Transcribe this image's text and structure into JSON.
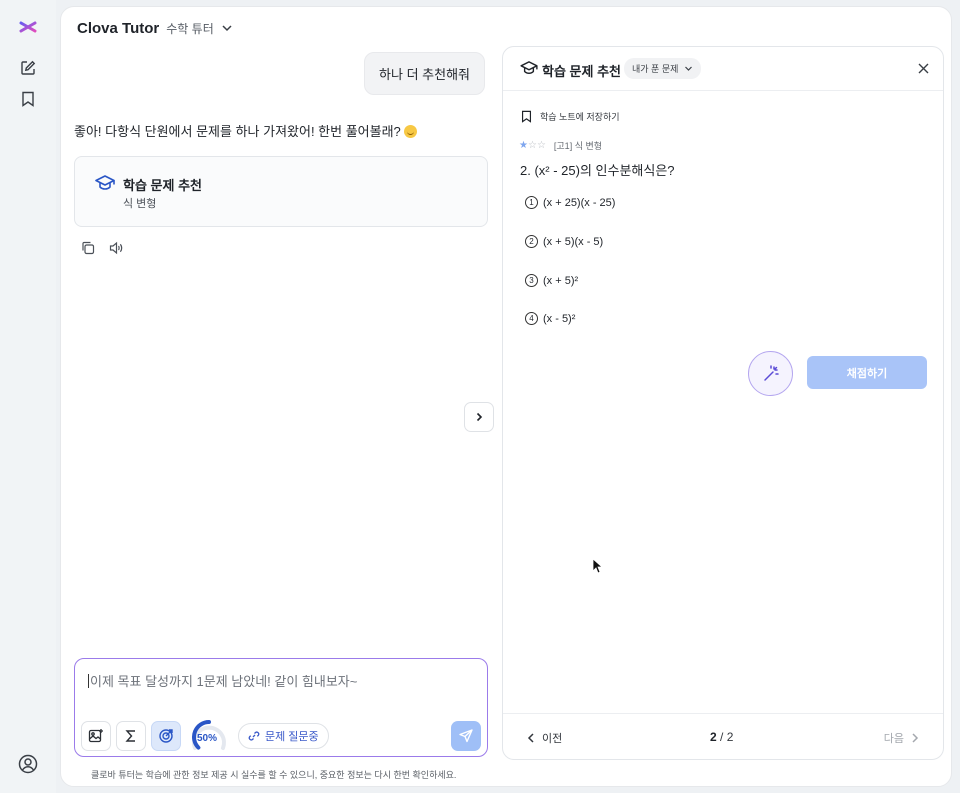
{
  "header": {
    "app_title": "Clova Tutor",
    "app_subtitle": "수학 튜터"
  },
  "chat": {
    "user_message": "하나 더 추천해줘",
    "bot_message": "좋아! 다항식 단원에서 문제를 하나 가져왔어! 한번 풀어볼래?",
    "recommend_card": {
      "title": "학습 문제 추천",
      "subtitle": "식 변형"
    }
  },
  "composer": {
    "placeholder": "이제 목표 달성까지 1문제 남았네! 같이 힘내보자~",
    "progress": {
      "percent": 50,
      "label": "50%"
    },
    "chip_label": "문제 질문중",
    "disclaimer": "클로바 튜터는 학습에 관한 정보 제공 시 실수를 할 수 있으니, 중요한 정보는 다시 한번 확인하세요."
  },
  "panel": {
    "title": "학습 문제 추천",
    "filter_label": "내가 푼 문제",
    "save_note": "학습 노트에 저장하기",
    "difficulty": {
      "filled": 1,
      "total": 3
    },
    "tag": "[고1] 식 변형",
    "question": "2. (x² - 25)의 인수분해식은?",
    "choices": [
      {
        "num": "1",
        "text": "(x + 25)(x - 25)"
      },
      {
        "num": "2",
        "text": "(x + 5)(x - 5)"
      },
      {
        "num": "3",
        "text": "(x + 5)²"
      },
      {
        "num": "4",
        "text": "(x - 5)²"
      }
    ],
    "grade_label": "채점하기",
    "footer": {
      "prev_label": "이전",
      "current_page": "2",
      "page_total": "/ 2",
      "next_label": "다음"
    }
  },
  "colors": {
    "accent_purple": "#9b7bea",
    "accent_blue": "#2a56c6",
    "grade_button": "#a9c4f8"
  }
}
